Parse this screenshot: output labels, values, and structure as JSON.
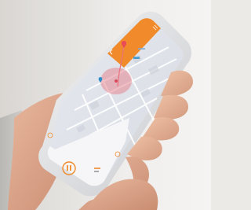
{
  "scene": {
    "description_hidden": "",
    "app": {
      "header_title": "",
      "time_left": "",
      "time_right": "",
      "button_right_label": ""
    },
    "colors": {
      "accent": "#f08a2a",
      "zone": "#e7737f",
      "map_road": "#ffffff",
      "map_block": "#d8dce6"
    },
    "icons": {
      "back": "back-arrow-icon",
      "menu": "menu-icon",
      "pause": "pause-icon",
      "start_pin": "start-pin-icon",
      "marker": "map-marker-icon"
    }
  }
}
